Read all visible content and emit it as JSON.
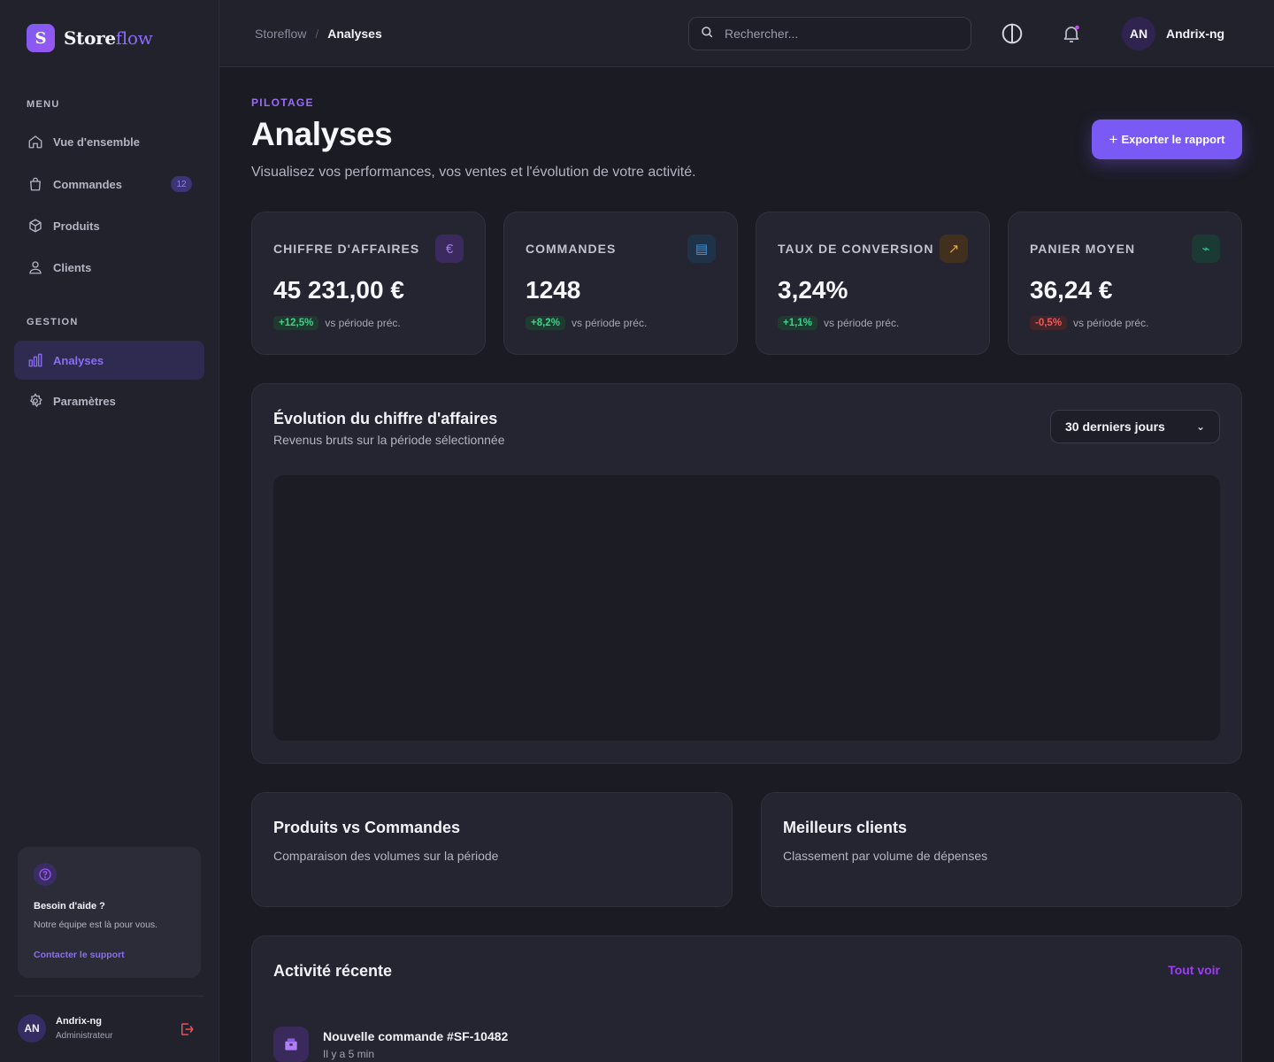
{
  "app": {
    "logo_letter": "S",
    "name_part1": "Store",
    "name_part2": "flow",
    "accent_color": "#7a5af5"
  },
  "sidebar": {
    "menu_label": "MENU",
    "gestion_label": "GESTION",
    "menu_items": [
      {
        "label": "Vue d'ensemble",
        "icon": "home-icon"
      },
      {
        "label": "Commandes",
        "icon": "shopping-bag-icon",
        "badge": "12"
      },
      {
        "label": "Produits",
        "icon": "box-icon"
      },
      {
        "label": "Clients",
        "icon": "users-icon"
      }
    ],
    "gestion_items": [
      {
        "label": "Analyses",
        "icon": "bar-chart-icon",
        "active": true
      },
      {
        "label": "Paramètres",
        "icon": "gear-icon"
      }
    ],
    "help": {
      "title": "Besoin d'aide ?",
      "text": "Notre équipe est là pour vous.",
      "link": "Contacter le support"
    },
    "user": {
      "initials": "AN",
      "name": "Andrix-ng",
      "role": "Administrateur"
    }
  },
  "header": {
    "breadcrumb_root": "Storeflow",
    "breadcrumb_sep": "/",
    "breadcrumb_current": "Analyses",
    "search_placeholder": "Rechercher...",
    "user_initials": "AN",
    "user_name": "Andrix-ng"
  },
  "page": {
    "eyebrow": "PILOTAGE",
    "title": "Analyses",
    "subtitle": "Visualisez vos performances, vos ventes et l'évolution de votre activité.",
    "export_plus": "+",
    "export_label": "Exporter le rapport"
  },
  "kpis": [
    {
      "label": "CHIFFRE D'AFFAIRES",
      "value": "45 231,00 €",
      "delta": "+12,5%",
      "trend": "up",
      "compare": "vs période préc.",
      "icon": "euro-icon",
      "glyph": "€",
      "icon_bg": "#3a2a5e",
      "icon_color": "#a77bf5"
    },
    {
      "label": "COMMANDES",
      "value": "1248",
      "delta": "+8,2%",
      "trend": "up",
      "compare": "vs période préc.",
      "icon": "list-icon",
      "glyph": "▤",
      "icon_bg": "#1f3248",
      "icon_color": "#3f95e8"
    },
    {
      "label": "TAUX DE CONVERSION",
      "value": "3,24%",
      "delta": "+1,1%",
      "trend": "up",
      "compare": "vs période préc.",
      "icon": "trend-arrow-icon",
      "glyph": "↗",
      "icon_bg": "#42301f",
      "icon_color": "#f0a23a"
    },
    {
      "label": "PANIER MOYEN",
      "value": "36,24 €",
      "delta": "-0,5%",
      "trend": "down",
      "compare": "vs période préc.",
      "icon": "wave-icon",
      "glyph": "⌁",
      "icon_bg": "#1b3a33",
      "icon_color": "#2fc79a"
    }
  ],
  "revenue_chart": {
    "title": "Évolution du chiffre d'affaires",
    "subtitle": "Revenus bruts sur la période sélectionnée",
    "range": "30 derniers jours",
    "chevron": "⌄"
  },
  "products_vs_orders": {
    "title": "Produits vs Commandes",
    "subtitle": "Comparaison des volumes sur la période"
  },
  "best_clients": {
    "title": "Meilleurs clients",
    "subtitle": "Classement par volume de dépenses"
  },
  "activity": {
    "title": "Activité récente",
    "view_all": "Tout voir",
    "items": [
      {
        "title": "Nouvelle commande #SF-10482",
        "time": "Il y a 5 min",
        "icon": "package-icon"
      }
    ]
  }
}
